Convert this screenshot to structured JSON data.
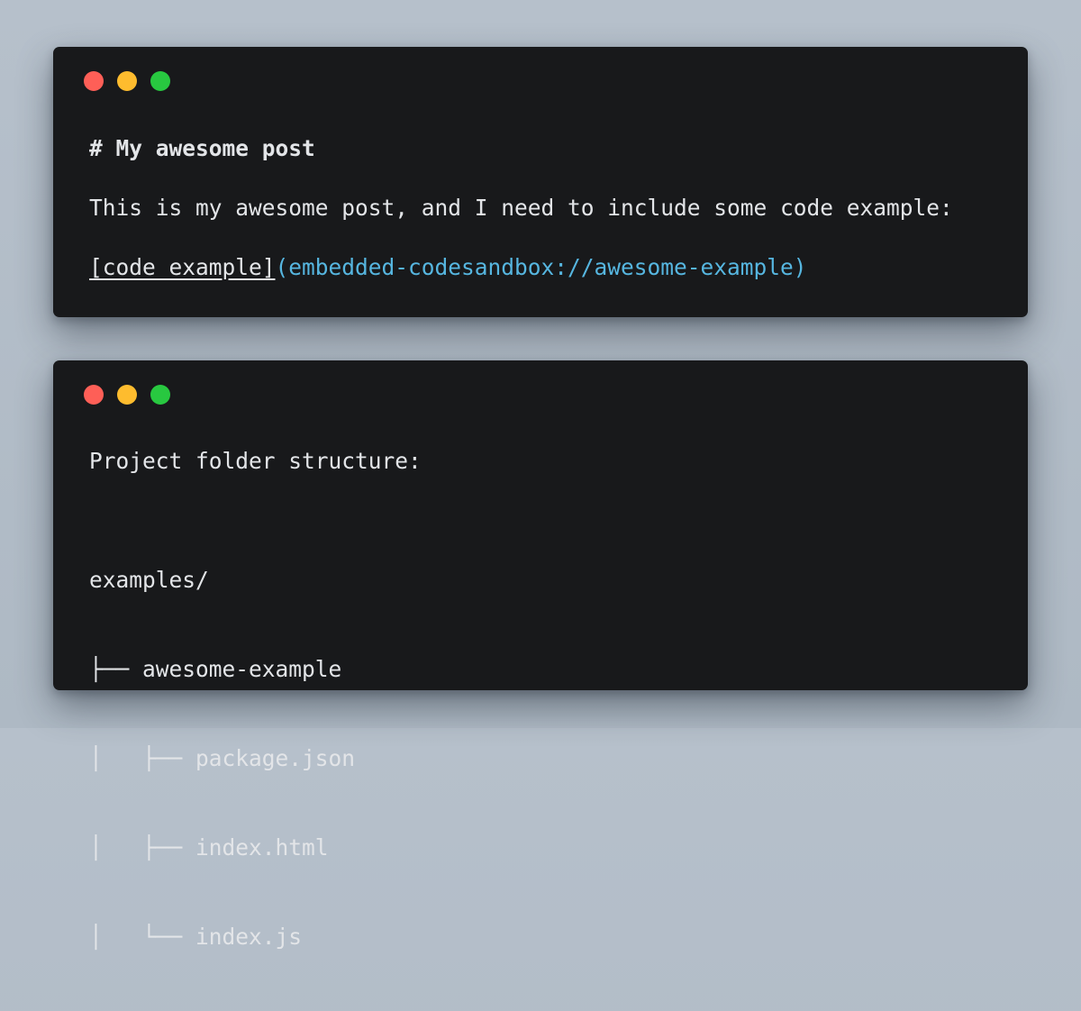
{
  "window_controls": {
    "close_color": "#fe5f57",
    "minimize_color": "#febc2e",
    "maximize_color": "#28c840"
  },
  "markdown_window": {
    "heading": "# My awesome post",
    "paragraph": "This is my awesome post, and I need to include some code example:",
    "link_text": "[code example]",
    "link_url": "(embedded-codesandbox://awesome-example)",
    "link_color": "#56b6e0"
  },
  "folder_window": {
    "title": "Project folder structure:",
    "tree": [
      "examples/",
      "├── awesome-example",
      "│   ├── package.json",
      "│   ├── index.html",
      "│   └── index.js"
    ]
  }
}
